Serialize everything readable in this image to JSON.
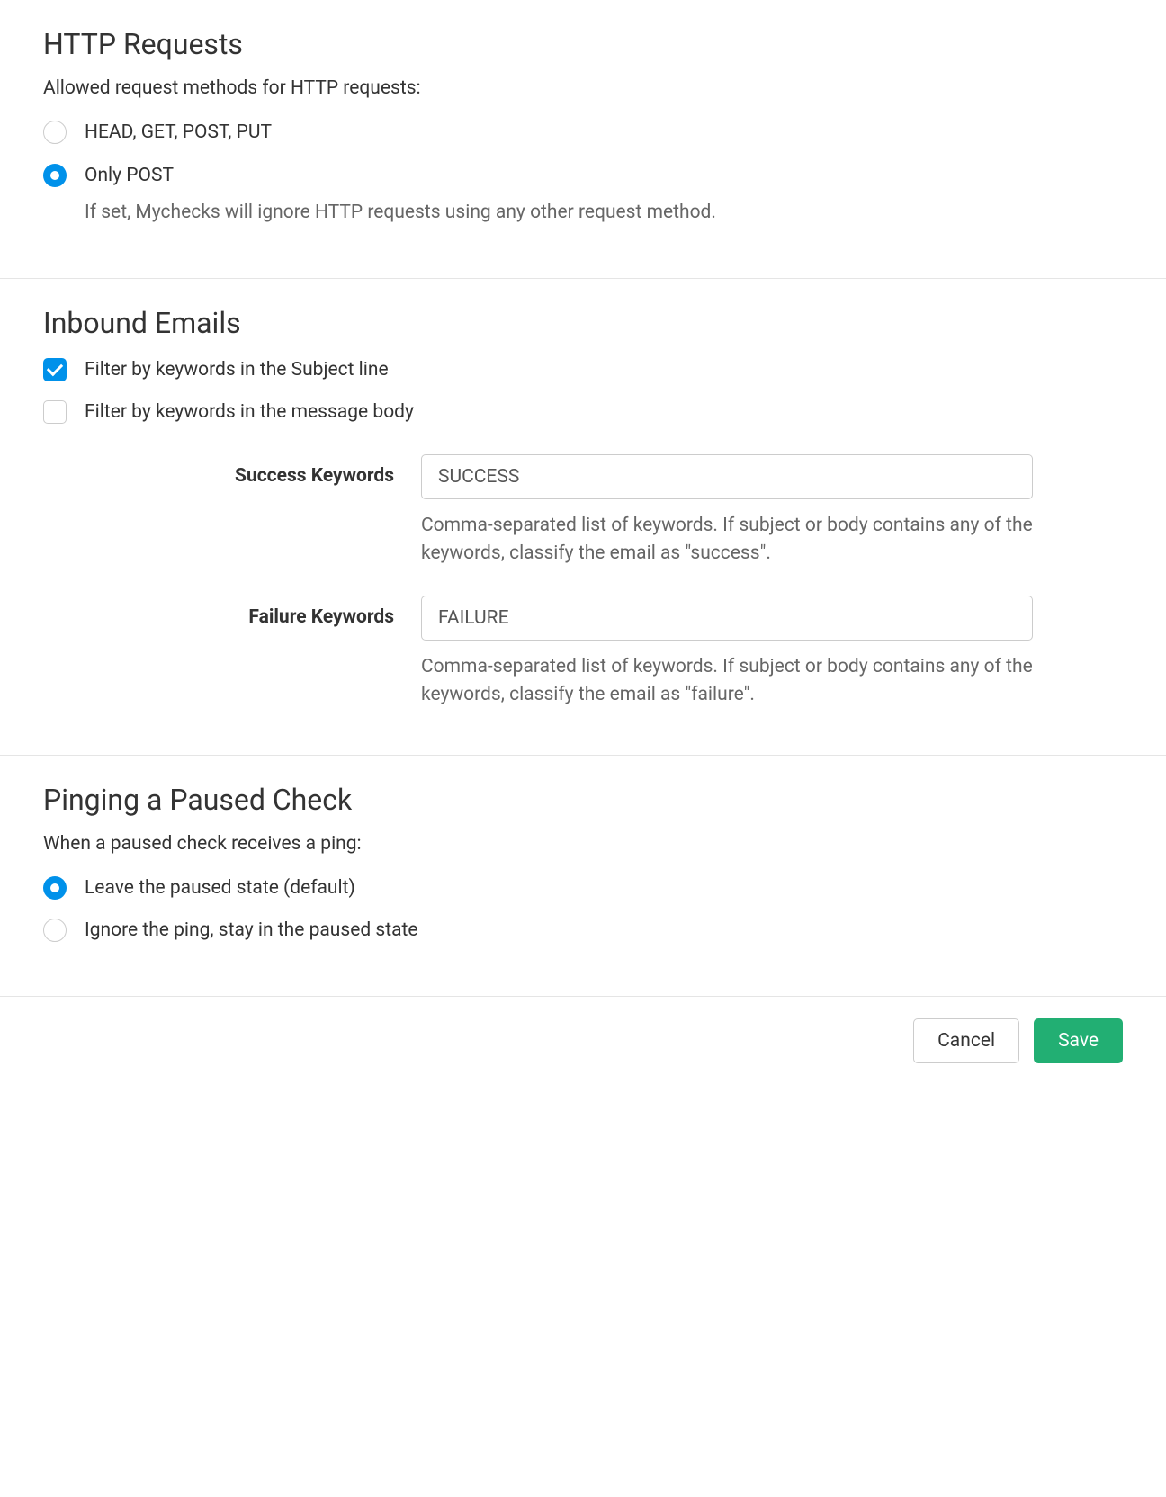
{
  "http_requests": {
    "title": "HTTP Requests",
    "description": "Allowed request methods for HTTP requests:",
    "options": [
      {
        "label": "HEAD, GET, POST, PUT",
        "checked": false
      },
      {
        "label": "Only POST",
        "help": "If set, Mychecks will ignore HTTP requests using any other request method.",
        "checked": true
      }
    ]
  },
  "inbound_emails": {
    "title": "Inbound Emails",
    "filters": [
      {
        "label": "Filter by keywords in the Subject line",
        "checked": true
      },
      {
        "label": "Filter by keywords in the message body",
        "checked": false
      }
    ],
    "success_keywords": {
      "label": "Success Keywords",
      "value": "SUCCESS",
      "help": "Comma-separated list of keywords. If subject or body contains any of the keywords, classify the email as \"success\"."
    },
    "failure_keywords": {
      "label": "Failure Keywords",
      "value": "FAILURE",
      "help": "Comma-separated list of keywords. If subject or body contains any of the keywords, classify the email as \"failure\"."
    }
  },
  "pinging_paused": {
    "title": "Pinging a Paused Check",
    "description": "When a paused check receives a ping:",
    "options": [
      {
        "label": "Leave the paused state (default)",
        "checked": true
      },
      {
        "label": "Ignore the ping, stay in the paused state",
        "checked": false
      }
    ]
  },
  "footer": {
    "cancel_label": "Cancel",
    "save_label": "Save"
  }
}
